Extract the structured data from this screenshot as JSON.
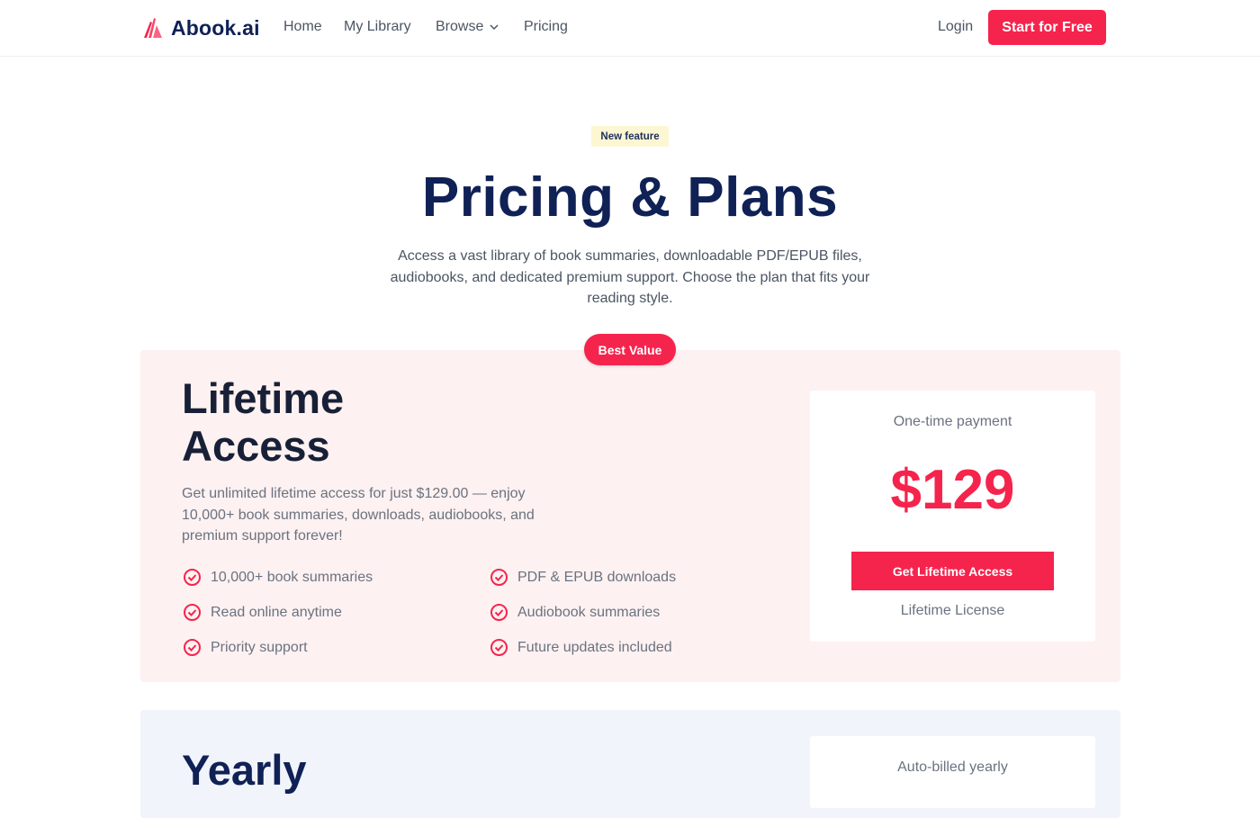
{
  "nav": {
    "brand": "Abook.ai",
    "links": [
      {
        "label": "Home"
      },
      {
        "label": "My Library"
      },
      {
        "label": "Browse"
      },
      {
        "label": "Pricing"
      }
    ],
    "login": "Login",
    "cta": "Start for Free"
  },
  "hero": {
    "badge": "New feature",
    "title": "Pricing & Plans",
    "subtitle": "Access a vast library of book summaries, downloadable PDF/EPUB files, audiobooks, and dedicated premium support. Choose the plan that fits your reading style."
  },
  "lifetime": {
    "badge": "Best Value",
    "title": "Lifetime Access",
    "description": "Get unlimited lifetime access for just $129.00 — enjoy 10,000+ book summaries, downloads, audiobooks, and premium support forever!",
    "features": [
      "10,000+ book summaries",
      "PDF & EPUB downloads",
      "Read online anytime",
      "Audiobook summaries",
      "Priority support",
      "Future updates included"
    ],
    "price_label": "One-time payment",
    "price": "$129",
    "button": "Get Lifetime Access",
    "license": "Lifetime License"
  },
  "yearly": {
    "title": "Yearly",
    "price_label": "Auto-billed yearly"
  },
  "colors": {
    "brand_navy": "#0f2155",
    "accent_red": "#f5244d",
    "lifetime_bg": "#fdf1f1",
    "yearly_bg": "#f1f4fb",
    "badge_yellow": "#fdf6d3"
  }
}
